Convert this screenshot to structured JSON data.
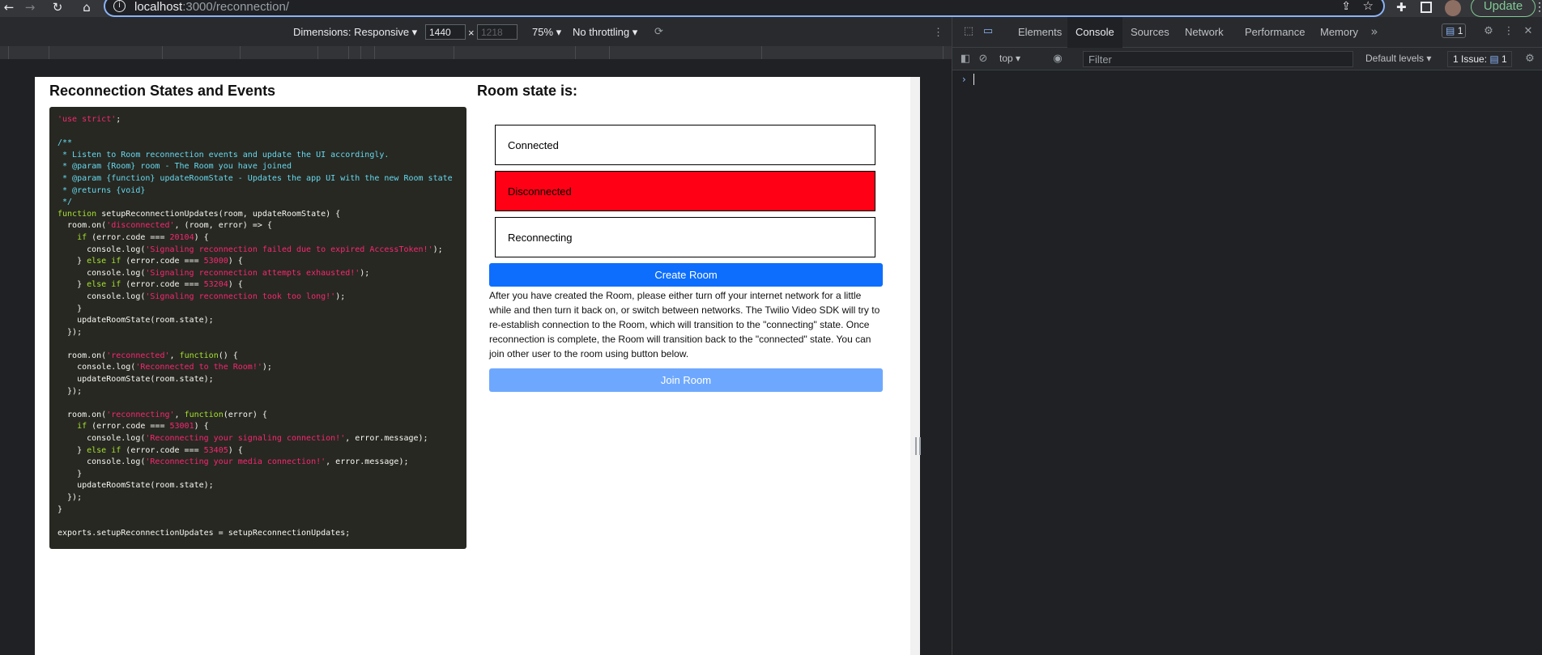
{
  "browser": {
    "back_icon": "←",
    "forward_icon": "→",
    "reload_icon": "↻",
    "home_icon": "⌂",
    "url_host": "localhost",
    "url_path": ":3000/reconnection/",
    "update_label": "Update"
  },
  "device_toolbar": {
    "dimensions_label": "Dimensions: Responsive ▾",
    "width_value": "1440",
    "height_placeholder": "1218",
    "times": "×",
    "zoom_label": "75% ▾",
    "throttle_label": "No throttling ▾"
  },
  "page": {
    "left_title": "Reconnection States and Events",
    "right_title": "Room state is:",
    "states": [
      "Connected",
      "Disconnected",
      "Reconnecting"
    ],
    "active_state_color": "#ff0015",
    "create_button": "Create Room",
    "info_text": "After you have created the Room, please either turn off your internet network for a little while and then turn it back on, or switch between networks. The Twilio Video SDK will try to re-establish connection to the Room, which will transition to the \"connecting\" state. Once reconnection is complete, the Room will transition back to the \"connected\" state. You can join other user to the room using button below.",
    "join_button": "Join Room"
  },
  "devtools": {
    "tabs": [
      "Elements",
      "Console",
      "Sources",
      "Network",
      "Performance",
      "Memory"
    ],
    "active_tab": "Console",
    "more_tabs": "»",
    "messages_badge": "1",
    "context": "top ▾",
    "filter_placeholder": "Filter",
    "levels": "Default levels ▾",
    "issues": "1 Issue: ",
    "issues_count": "1",
    "prompt": "›"
  }
}
